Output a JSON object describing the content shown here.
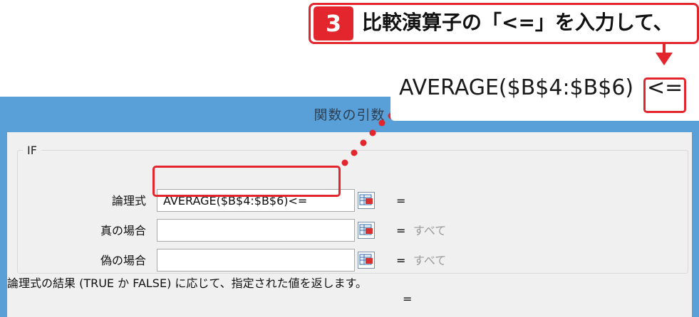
{
  "callout": {
    "step_number": "3",
    "text": "比較演算子の「<=」を入力して、"
  },
  "zoom": {
    "formula": "AVERAGE($B$4:$B$6)",
    "operator": "<="
  },
  "dialog": {
    "title": "関数の引数",
    "function_name": "IF",
    "arguments": [
      {
        "label": "論理式",
        "value": "AVERAGE($B$4:$B$6)<=",
        "equals": "=",
        "result": ""
      },
      {
        "label": "真の場合",
        "value": "",
        "equals": "=",
        "result": "すべて"
      },
      {
        "label": "偽の場合",
        "value": "",
        "equals": "=",
        "result": "すべて"
      }
    ],
    "result_equals": "=",
    "description": "論理式の結果 (TRUE か FALSE) に応じて、指定された値を返します。"
  },
  "colors": {
    "highlight": "#e3262d",
    "title_bar": "#5aa0d8",
    "dialog_bg": "#f0f0f0"
  },
  "icons": {
    "collapse_button": "range-select-icon"
  }
}
